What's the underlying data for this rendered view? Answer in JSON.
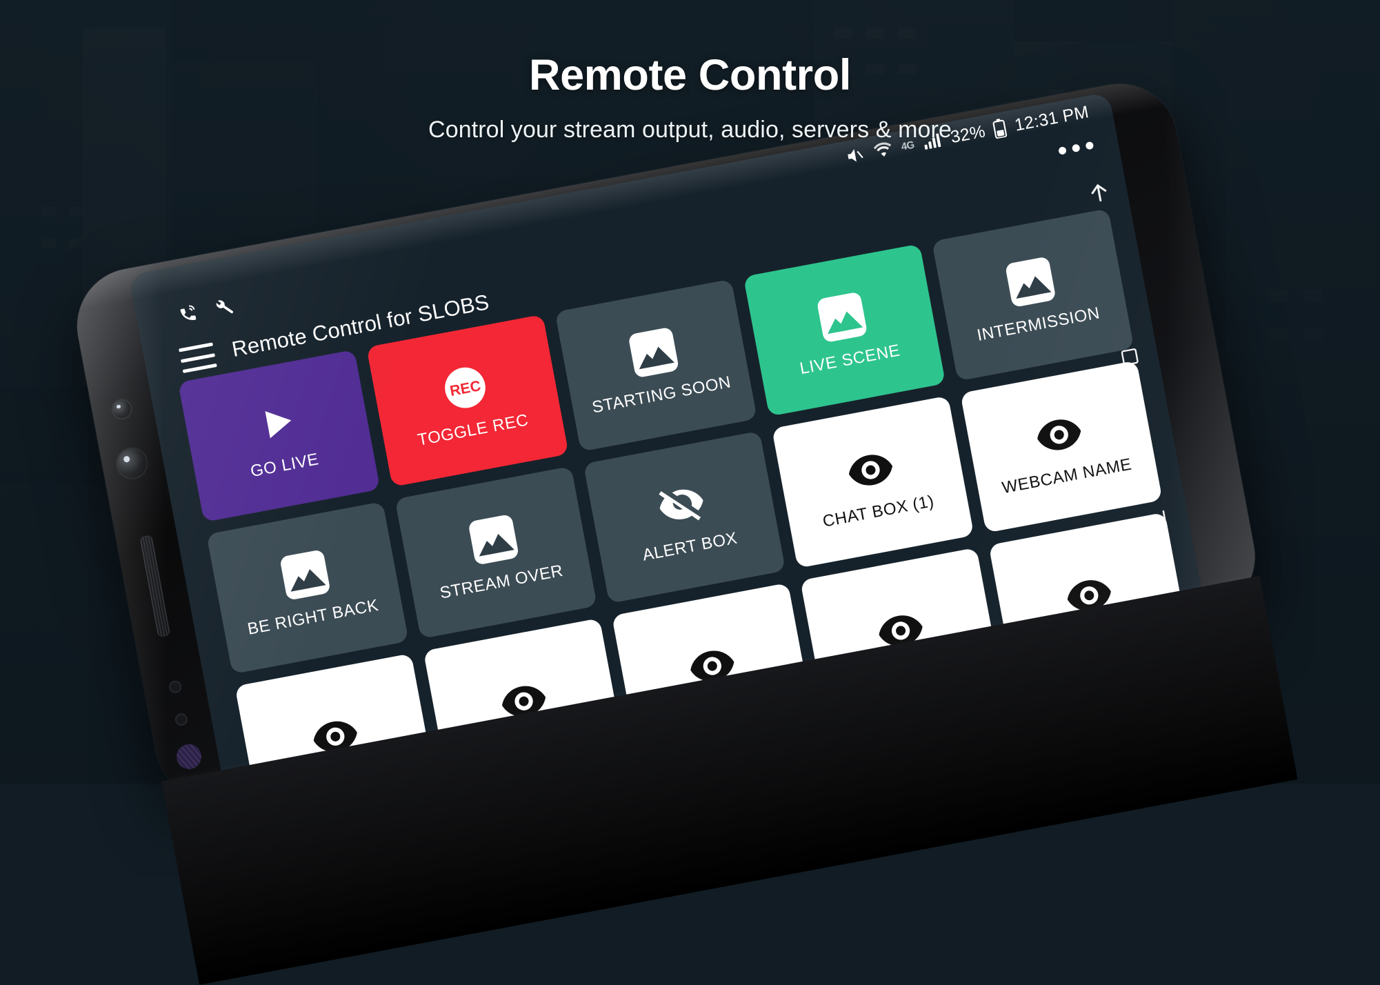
{
  "hero": {
    "title": "Remote Control",
    "subtitle": "Control your stream output, audio, servers & more"
  },
  "colors": {
    "page_background": "#111c24",
    "screen_background": "#16222b",
    "tile_slate": "#3c4c55",
    "tile_purple": "#512d94",
    "tile_red": "#f32735",
    "tile_teal": "#2ec48e",
    "tile_white": "#ffffff"
  },
  "phone": {
    "status_bar": {
      "mute_icon": "volume-mute-icon",
      "wifi_icon": "wifi-icon",
      "network_label": "4G",
      "signal_icon": "signal-bars-icon",
      "battery_percent": "32%",
      "battery_icon": "battery-icon",
      "time": "12:31 PM"
    },
    "overflow_menu": "overflow-menu-icon",
    "nav_bar": {
      "back": "back-arrow-icon",
      "recents": "recents-square-icon",
      "home": "home-icon"
    }
  },
  "app": {
    "title": "Remote Control for SLOBS",
    "menu_icon": "hamburger-menu-icon",
    "status_icons": [
      {
        "name": "connection-icon",
        "label": "Connection"
      },
      {
        "name": "wrench-icon",
        "label": "Settings"
      }
    ],
    "tiles": [
      {
        "label": "GO LIVE",
        "icon": "play-icon",
        "style": "t-purple"
      },
      {
        "label": "TOGGLE REC",
        "icon": "rec-icon",
        "style": "t-red"
      },
      {
        "label": "STARTING SOON",
        "icon": "image-icon",
        "style": "t-slate"
      },
      {
        "label": "LIVE SCENE",
        "icon": "image-icon",
        "style": "t-teal"
      },
      {
        "label": "INTERMISSION",
        "icon": "image-icon",
        "style": "t-slate"
      },
      {
        "label": "BE RIGHT BACK",
        "icon": "image-icon",
        "style": "t-slate"
      },
      {
        "label": "STREAM OVER",
        "icon": "image-icon",
        "style": "t-slate"
      },
      {
        "label": "ALERT BOX",
        "icon": "eye-slash-icon",
        "style": "t-slate"
      },
      {
        "label": "CHAT BOX (1)",
        "icon": "eye-icon",
        "style": "t-white"
      },
      {
        "label": "WEBCAM NAME",
        "icon": "eye-icon",
        "style": "t-white"
      },
      {
        "label": "",
        "icon": "eye-icon",
        "style": "t-white"
      },
      {
        "label": "",
        "icon": "eye-icon",
        "style": "t-white"
      },
      {
        "label": "",
        "icon": "eye-icon",
        "style": "t-white"
      },
      {
        "label": "",
        "icon": "eye-icon",
        "style": "t-white"
      },
      {
        "label": "",
        "icon": "eye-icon",
        "style": "t-white"
      }
    ]
  }
}
